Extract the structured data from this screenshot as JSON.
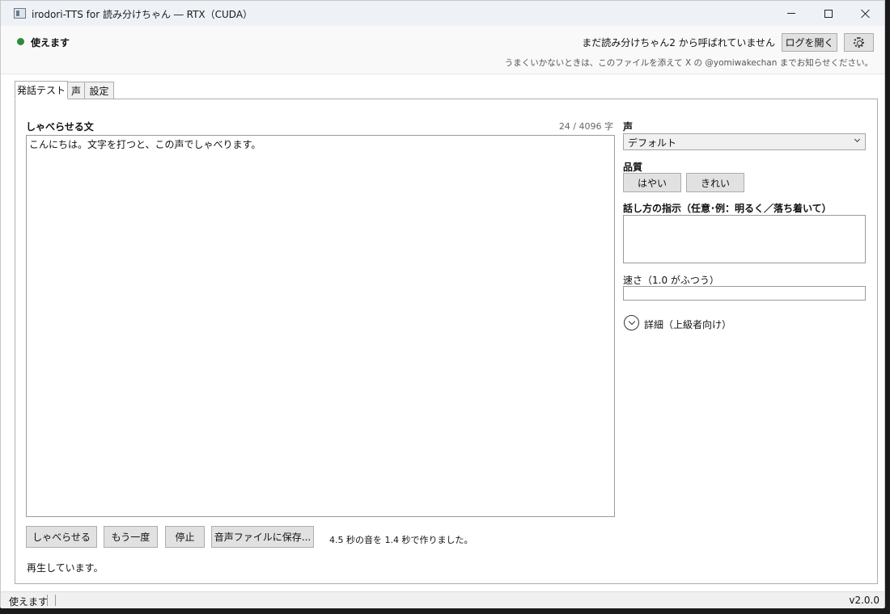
{
  "window": {
    "title": "irodori-TTS for 読み分けちゃん ― RTX（CUDA）"
  },
  "header": {
    "status": "使えます",
    "status_color": "#2e8b3a",
    "not_called": "まだ読み分けちゃん2 から呼ばれていません",
    "log_button": "ログを開く",
    "help": "うまくいかないときは、このファイルを添えて X の @yomiwakechan までお知らせください。"
  },
  "tabs": [
    {
      "label": "発話テスト",
      "active": true
    },
    {
      "label": "声",
      "active": false
    },
    {
      "label": "設定",
      "active": false
    }
  ],
  "test": {
    "text_label": "しゃべらせる文",
    "char_count": "24 / 4096 字",
    "text_value": "こんにちは。文字を打つと、この声でしゃべります。",
    "buttons": {
      "speak": "しゃべらせる",
      "again": "もう一度",
      "stop": "停止",
      "save": "音声ファイルに保存..."
    },
    "generation_info": "4.5 秒の音を 1.4 秒で作りました。",
    "playing": "再生しています。"
  },
  "side": {
    "voice_label": "声",
    "voice_selected": "デフォルト",
    "quality_label": "品質",
    "quality_fast": "はやい",
    "quality_clean": "きれい",
    "instruction_label": "話し方の指示（任意･例：明るく／落ち着いて）",
    "speed_label": "速さ（1.0 がふつう）",
    "details_label": "詳細（上級者向け）"
  },
  "statusbar": {
    "text": "使えます",
    "version": "v2.0.0"
  }
}
